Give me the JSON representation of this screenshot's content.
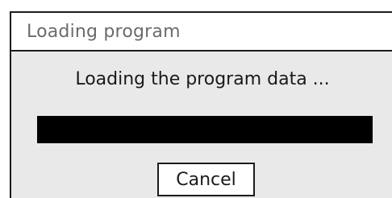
{
  "window": {
    "title": "Loading program"
  },
  "dialog": {
    "message": "Loading the program data ...",
    "progress_fraction": 1.0,
    "cancel_label": "Cancel"
  },
  "colors": {
    "progress_fill": "#000000",
    "dialog_background": "#e9e9e9",
    "title_text": "#6b6b6b"
  }
}
